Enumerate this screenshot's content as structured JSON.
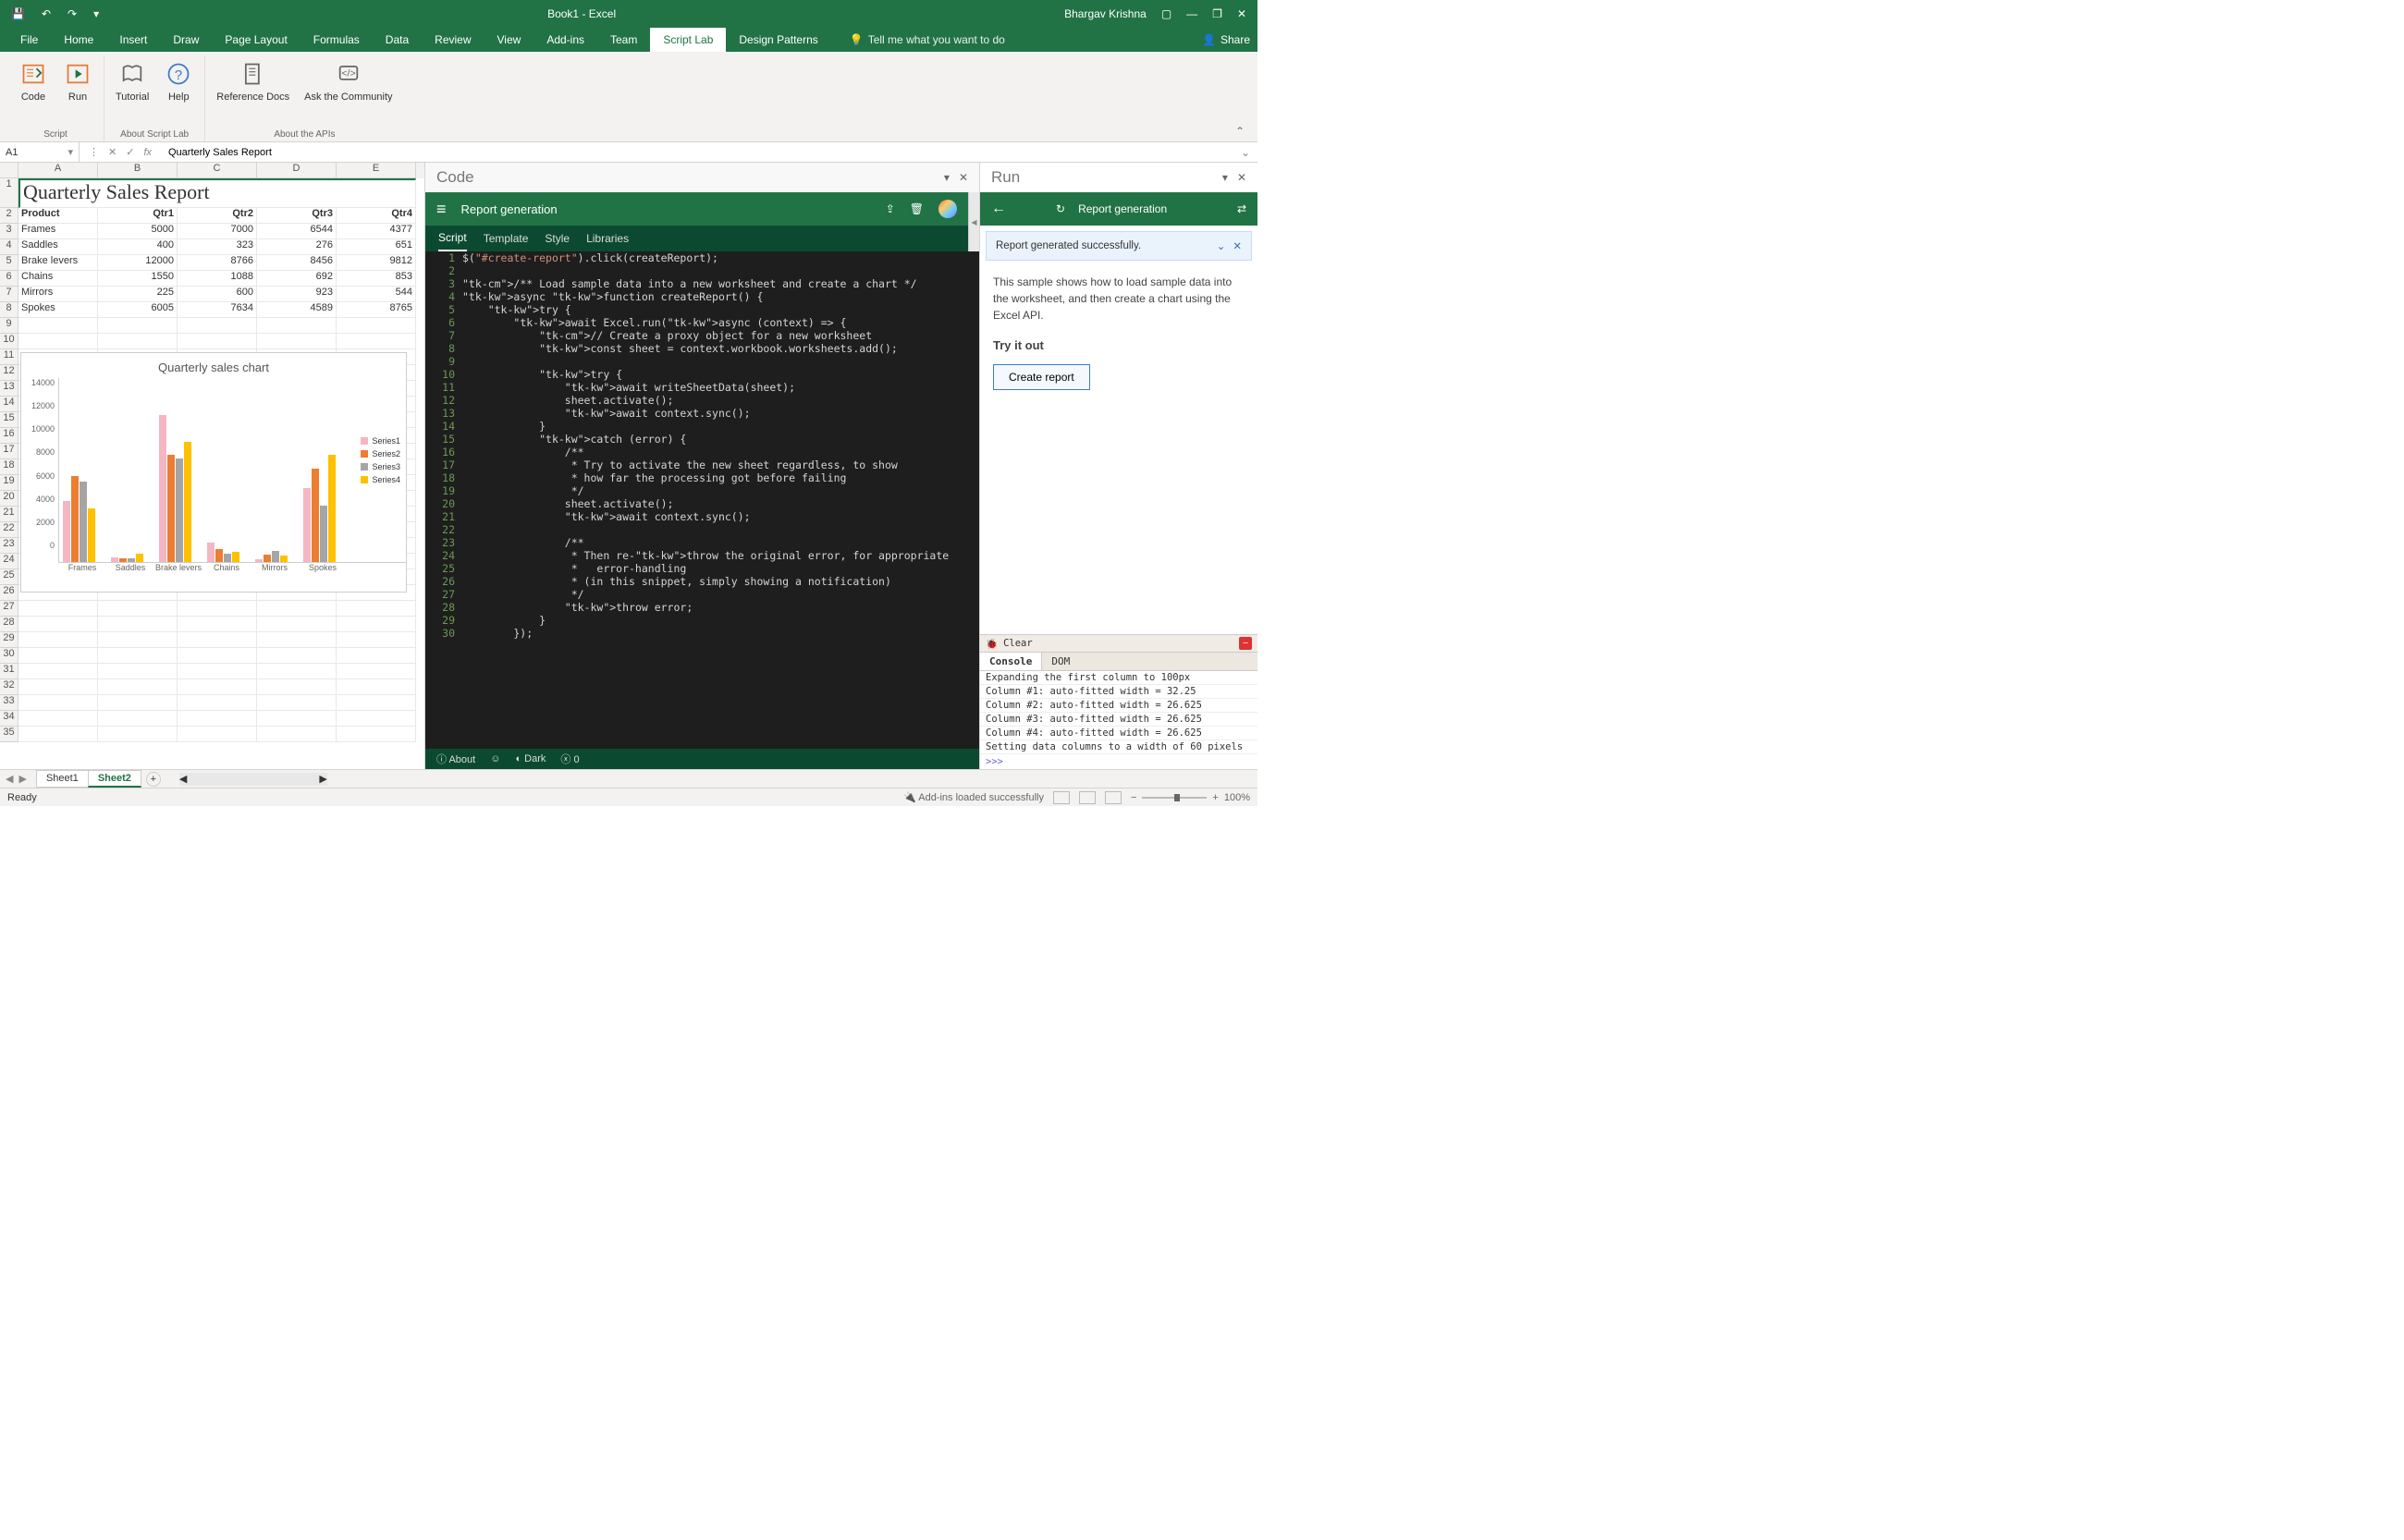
{
  "title_bar": {
    "document": "Book1  -  Excel",
    "user": "Bhargav Krishna"
  },
  "ribbon_tabs": [
    "File",
    "Home",
    "Insert",
    "Draw",
    "Page Layout",
    "Formulas",
    "Data",
    "Review",
    "View",
    "Add-ins",
    "Team",
    "Script Lab",
    "Design Patterns"
  ],
  "active_tab": "Script Lab",
  "tell_me": "Tell me what you want to do",
  "share": "Share",
  "ribbon": {
    "group1": {
      "label": "Script",
      "items": [
        "Code",
        "Run"
      ]
    },
    "group2": {
      "label": "About Script Lab",
      "items": [
        "Tutorial",
        "Help"
      ]
    },
    "group3": {
      "label": "About the APIs",
      "items": [
        "Reference Docs",
        "Ask the Community"
      ]
    }
  },
  "formula_bar": {
    "name_box": "A1",
    "fx": "fx",
    "value": "Quarterly Sales Report"
  },
  "sheet": {
    "columns": [
      "A",
      "B",
      "C",
      "D",
      "E"
    ],
    "title": "Quarterly Sales Report",
    "headers": [
      "Product",
      "Qtr1",
      "Qtr2",
      "Qtr3",
      "Qtr4"
    ],
    "rows": [
      {
        "p": "Frames",
        "q": [
          5000,
          7000,
          6544,
          4377
        ]
      },
      {
        "p": "Saddles",
        "q": [
          400,
          323,
          276,
          651
        ]
      },
      {
        "p": "Brake levers",
        "q": [
          12000,
          8766,
          8456,
          9812
        ]
      },
      {
        "p": "Chains",
        "q": [
          1550,
          1088,
          692,
          853
        ]
      },
      {
        "p": "Mirrors",
        "q": [
          225,
          600,
          923,
          544
        ]
      },
      {
        "p": "Spokes",
        "q": [
          6005,
          7634,
          4589,
          8765
        ]
      }
    ]
  },
  "chart_data": {
    "type": "bar",
    "title": "Quarterly sales chart",
    "categories": [
      "Frames",
      "Saddles",
      "Brake levers",
      "Chains",
      "Mirrors",
      "Spokes"
    ],
    "series": [
      {
        "name": "Series1",
        "values": [
          5000,
          400,
          12000,
          1550,
          225,
          6005
        ],
        "color": "#f4b6c2"
      },
      {
        "name": "Series2",
        "values": [
          7000,
          323,
          8766,
          1088,
          600,
          7634
        ],
        "color": "#ed7d31"
      },
      {
        "name": "Series3",
        "values": [
          6544,
          276,
          8456,
          692,
          923,
          4589
        ],
        "color": "#a5a5a5"
      },
      {
        "name": "Series4",
        "values": [
          4377,
          651,
          9812,
          853,
          544,
          8765
        ],
        "color": "#ffc000"
      }
    ],
    "ylabel": "",
    "xlabel": "",
    "ylim": [
      0,
      14000
    ],
    "yticks": [
      0,
      2000,
      4000,
      6000,
      8000,
      10000,
      12000,
      14000
    ]
  },
  "code_pane": {
    "title": "Code",
    "toolbar_title": "Report generation",
    "tabs": [
      "Script",
      "Template",
      "Style",
      "Libraries"
    ],
    "active_tab": "Script",
    "status": {
      "about": "About",
      "dark": "Dark",
      "errors": "0"
    },
    "lines": [
      "$(\"#create-report\").click(createReport);",
      "",
      "/** Load sample data into a new worksheet and create a chart */",
      "async function createReport() {",
      "    try {",
      "        await Excel.run(async (context) => {",
      "            // Create a proxy object for a new worksheet",
      "            const sheet = context.workbook.worksheets.add();",
      "",
      "            try {",
      "                await writeSheetData(sheet);",
      "                sheet.activate();",
      "                await context.sync();",
      "            }",
      "            catch (error) {",
      "                /**",
      "                 * Try to activate the new sheet regardless, to show",
      "                 * how far the processing got before failing",
      "                 */",
      "                sheet.activate();",
      "                await context.sync();",
      "",
      "                /**",
      "                 * Then re-throw the original error, for appropriate",
      "                 *   error-handling",
      "                 * (in this snippet, simply showing a notification)",
      "                 */",
      "                throw error;",
      "            }",
      "        });"
    ]
  },
  "run_pane": {
    "title": "Run",
    "toolbar_title": "Report generation",
    "notice": "Report generated successfully.",
    "loop_icon": "↻",
    "desc": "This sample shows how to load sample data into the worksheet, and then create a chart using the Excel API.",
    "try_header": "Try it out",
    "button": "Create report",
    "console": {
      "clear": "Clear",
      "tabs": [
        "Console",
        "DOM"
      ],
      "active": "Console",
      "lines": [
        "Expanding the first column to 100px",
        "Column #1: auto-fitted width = 32.25",
        "Column #2: auto-fitted width = 26.625",
        "Column #3: auto-fitted width = 26.625",
        "Column #4: auto-fitted width = 26.625",
        "Setting data columns to a width of 60 pixels"
      ],
      "prompt": ">>>"
    }
  },
  "sheet_tabs": {
    "tabs": [
      "Sheet1",
      "Sheet2"
    ],
    "active": "Sheet2"
  },
  "status_bar": {
    "ready": "Ready",
    "addins": "Add-ins loaded successfully",
    "zoom": "100%"
  }
}
